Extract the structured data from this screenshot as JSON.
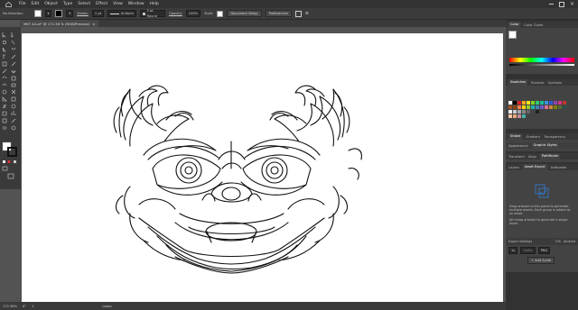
{
  "app": {
    "name": "Illustrator"
  },
  "menu": [
    "File",
    "Edit",
    "Object",
    "Type",
    "Select",
    "Effect",
    "View",
    "Window",
    "Help"
  ],
  "control_bar": {
    "selection": "No Selection",
    "stroke_label": "Stroke:",
    "stroke_value": "1 pt",
    "profile_label": "Uniform",
    "brush_label": "5 pt. Round",
    "opacity_label": "Opacity:",
    "opacity_value": "100%",
    "style_label": "Style:",
    "doc_setup": "Document Setup",
    "preferences": "Preferences"
  },
  "document_tab": {
    "title": "MKT A4.ai* @ 172.36 % (RGB/Preview)",
    "close": "×"
  },
  "status_bar": {
    "zoom": "172.36%",
    "rotate": "0°",
    "artboard": "1",
    "tool": "Lasso"
  },
  "panels": {
    "color": {
      "tabs": [
        "Color",
        "Color Guide"
      ]
    },
    "swatches": {
      "tabs": [
        "Swatches",
        "Brushes",
        "Symbols"
      ]
    },
    "stroke": {
      "tabs": [
        "Stroke",
        "Gradient",
        "Transparency"
      ]
    },
    "appearance": {
      "tabs": [
        "Appearance",
        "Graphic Styles"
      ]
    },
    "transform": {
      "tabs": [
        "Transform",
        "Align",
        "Pathfinder"
      ]
    },
    "layers": {
      "tabs": [
        "Layers",
        "Asset Export",
        "Artboards"
      ]
    },
    "asset_export": {
      "hint1": "Drag artwork to this panel to generate multiple assets. Each group is added as an asset.",
      "hint2": "Alt+drag artwork to generate a single asset.",
      "export_settings": "Export Settings",
      "ios": "iOS",
      "android": "Android",
      "scale": "1x",
      "suffix": "Suffix",
      "format": "PNG",
      "add_scale": "+ Add Scale"
    }
  },
  "colors": {
    "accent": "#2f7fd9",
    "artboard": "#ffffff",
    "pasteboard": "#535353"
  }
}
